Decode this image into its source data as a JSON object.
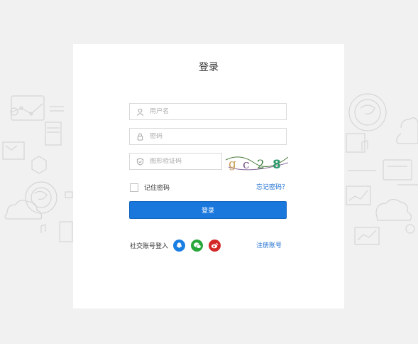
{
  "login": {
    "title": "登录",
    "username_placeholder": "用户名",
    "password_placeholder": "密码",
    "captcha_placeholder": "图形验证码",
    "captcha_text": [
      "g",
      "c",
      "2",
      "8"
    ],
    "remember_label": "记住密码",
    "forgot_label": "忘记密码？",
    "submit_label": "登录",
    "social_label": "社交账号登入",
    "register_label": "注册账号"
  },
  "colors": {
    "accent": "#1a78dd",
    "qq": "#1a7fe3",
    "wechat": "#28a83c",
    "weibo": "#d42727"
  },
  "icons": [
    "user-icon",
    "lock-icon",
    "shield-icon",
    "qq-icon",
    "wechat-icon",
    "weibo-icon"
  ]
}
